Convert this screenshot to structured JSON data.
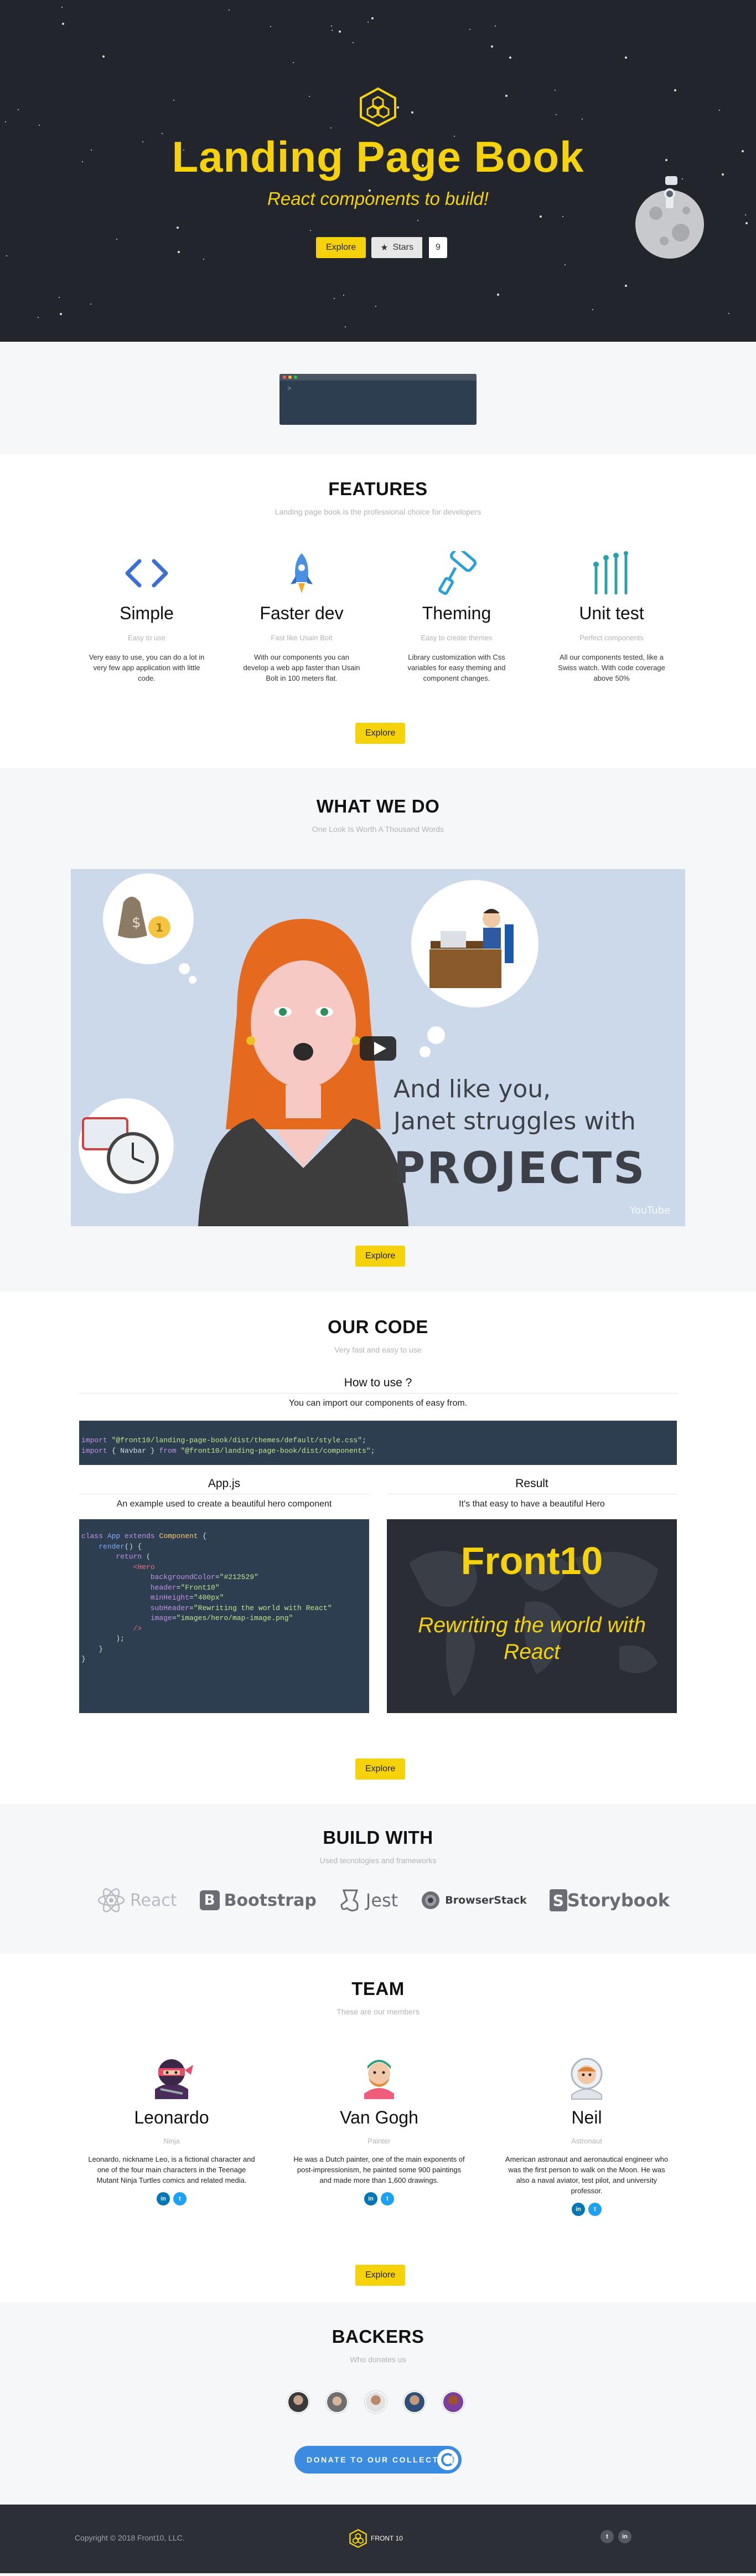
{
  "hero": {
    "title": "Landing Page Book",
    "subtitle": "React components to build!",
    "explore_label": "Explore",
    "stars_label": "Stars",
    "stars_count": "9",
    "accent": "#f5d20a",
    "background": "#23252d"
  },
  "features": {
    "title": "FEATURES",
    "subtitle": "Landing page book is the professional choice for developers",
    "explore_label": "Explore",
    "items": [
      {
        "icon": "code-icon",
        "title": "Simple",
        "subtitle": "Easy to use",
        "description": "Very easy to use, you can do a lot in very few app application with little code."
      },
      {
        "icon": "rocket-icon",
        "title": "Faster dev",
        "subtitle": "Fast like Usain Bolt",
        "description": "With our components you can develop a web app faster than Usain Bolt in 100 meters flat."
      },
      {
        "icon": "paint-roller-icon",
        "title": "Theming",
        "subtitle": "Easy to create themes",
        "description": "Library customization with Css variables for easy theming and component changes."
      },
      {
        "icon": "test-tubes-icon",
        "title": "Unit test",
        "subtitle": "Perfect components",
        "description": "All our components tested, like a Swiss watch. With code coverage above 50%"
      }
    ]
  },
  "whatwedo": {
    "title": "WHAT WE DO",
    "subtitle": "One Look Is Worth A Thousand Words",
    "video_line1": "And like you,",
    "video_line2": "Janet struggles with",
    "video_line3": "PROJECTS",
    "video_brand": "YouTube",
    "explore_label": "Explore"
  },
  "ourcode": {
    "title": "OUR CODE",
    "subtitle": "Very fast and easy to use",
    "howto_title": "How to use ?",
    "howto_sub": "You can import our components of easy from.",
    "import1_kw": "import",
    "import1_str": "\"@front10/landing-page-book/dist/themes/default/style.css\"",
    "import2_kw": "import",
    "import2_names": "{ Navbar }",
    "import2_from": "from",
    "import2_str": "\"@front10/landing-page-book/dist/components\"",
    "appjs_title": "App.js",
    "appjs_sub": "An example used to create a beautiful hero component",
    "result_title": "Result",
    "result_sub": "It's that easy to have a beautiful Hero",
    "result_hero_title": "Front10",
    "result_hero_sub": "Rewriting the world with React",
    "explore_label": "Explore"
  },
  "buildwith": {
    "title": "BUILD WITH",
    "subtitle": "Used tecnologies and frameworks",
    "logos": [
      "React",
      "Bootstrap",
      "Jest",
      "BrowserStack",
      "Storybook"
    ]
  },
  "team": {
    "title": "TEAM",
    "subtitle": "These are our members",
    "explore_label": "Explore",
    "members": [
      {
        "name": "Leonardo",
        "role": "Ninja",
        "description": "Leonardo, nickname Leo, is a fictional character and one of the four main characters in the Teenage Mutant Ninja Turtles comics and related media."
      },
      {
        "name": "Van Gogh",
        "role": "Painter",
        "description": "He was a Dutch painter, one of the main exponents of post-impressionism, he painted some 900 paintings and made more than 1,600 drawings."
      },
      {
        "name": "Neil",
        "role": "Astronaut",
        "description": "American astronaut and aeronautical engineer who was the first person to walk on the Moon. He was also a naval aviator, test pilot, and university professor."
      }
    ]
  },
  "backers": {
    "title": "BACKERS",
    "subtitle": "Who donates us",
    "donate_label": "DONATE TO OUR COLLECTIVE"
  },
  "footer": {
    "copyright": "Copyright © 2018 Front10, LLC.",
    "brand": "FRONT 10"
  }
}
